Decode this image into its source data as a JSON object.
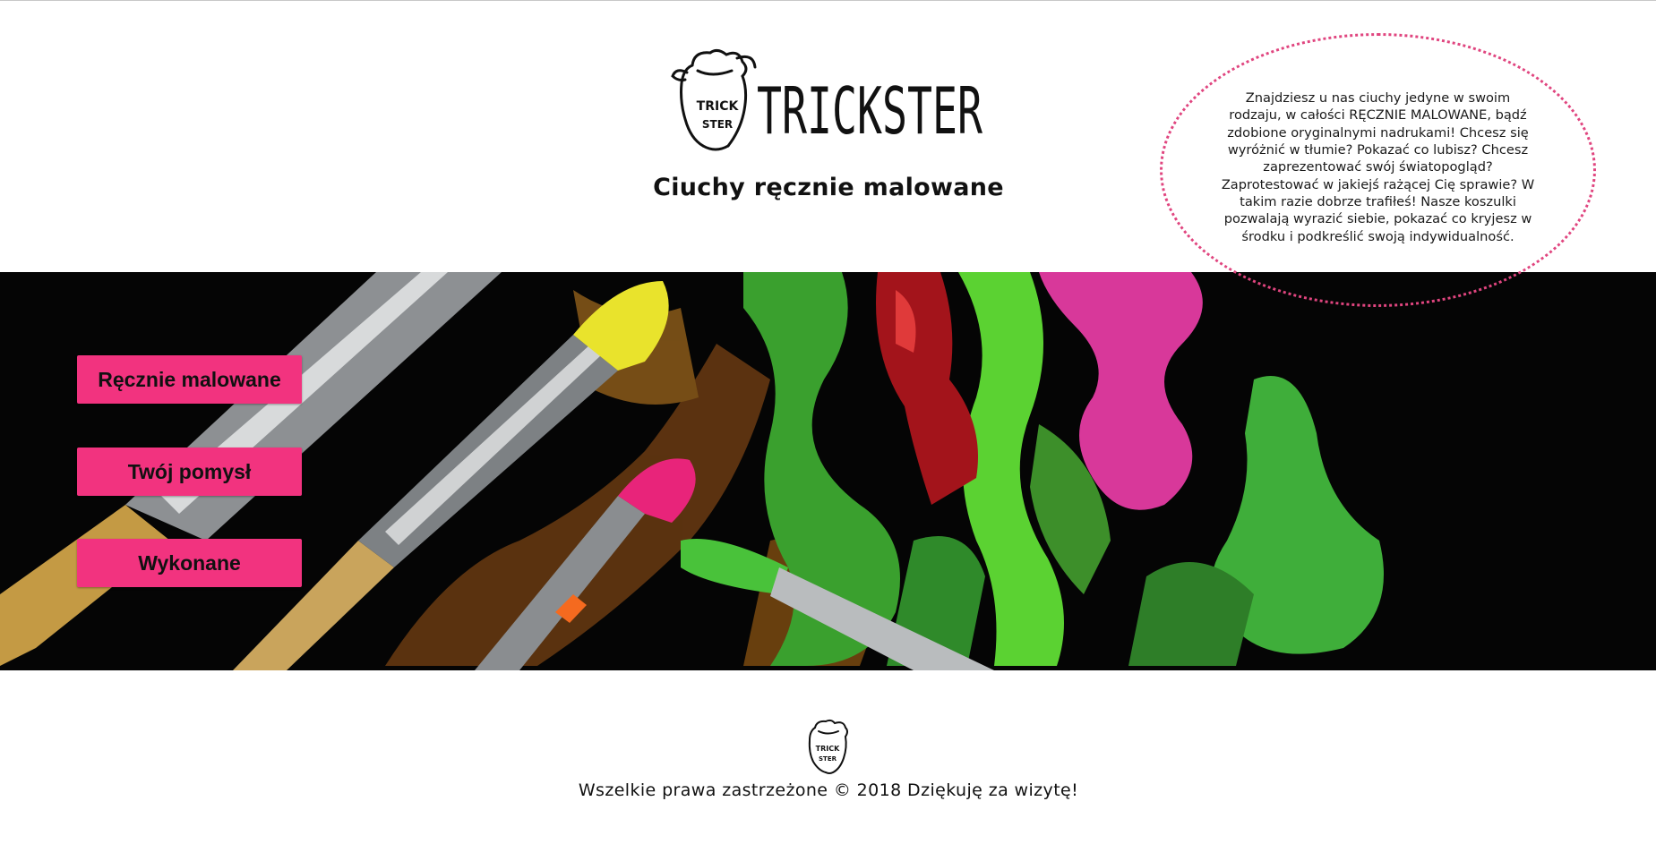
{
  "header": {
    "logo_wordmark": "TRICKSTER",
    "logo_badge_line1": "TRICK",
    "logo_badge_line2": "STER",
    "tagline": "Ciuchy ręcznie malowane"
  },
  "bubble": {
    "text": "Znajdziesz u nas ciuchy jedyne w swoim rodzaju, w całości RĘCZNIE MALOWANE, bądź zdobione oryginalnymi nadrukami! Chcesz się wyróżnić w tłumie? Pokazać co lubisz? Chcesz zaprezentować swój światopogląd? Zaprotestować w jakiejś rażącej Cię sprawie? W takim razie dobrze trafiłeś! Nasze koszulki pozwalają wyrazić siebie, pokazać co kryjesz w środku i podkreślić swoją indywidualność.",
    "border_color": "#e0457f"
  },
  "nav": {
    "items": [
      {
        "label": "Ręcznie malowane"
      },
      {
        "label": "Twój pomysł"
      },
      {
        "label": "Wykonane"
      }
    ],
    "button_color": "#f2337f"
  },
  "footer": {
    "copyright": "Wszelkie prawa zastrzeżone © 2018 Dziękuję za wizytę!"
  }
}
